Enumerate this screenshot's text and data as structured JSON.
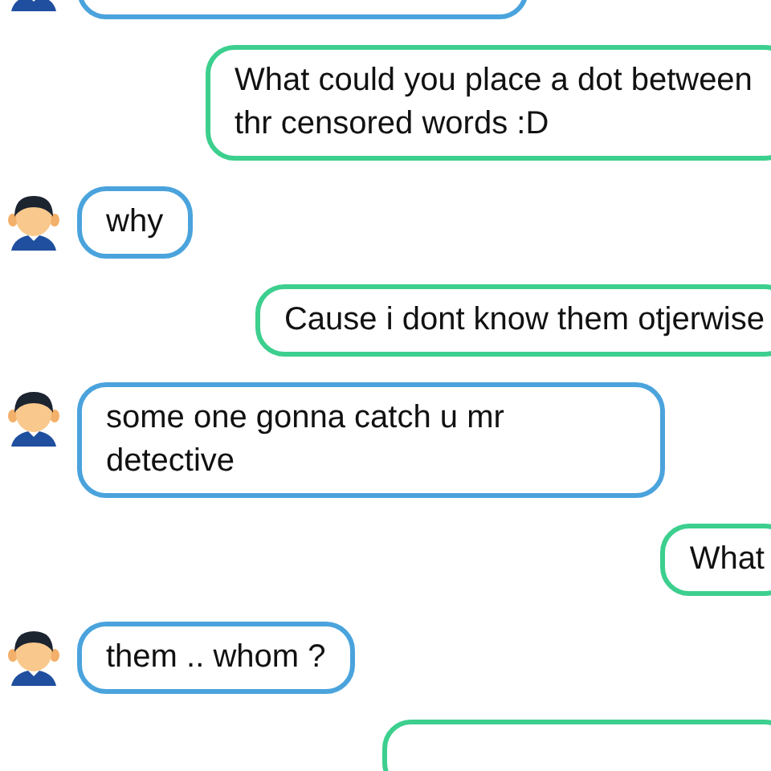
{
  "messages": [
    {
      "kind": "incoming"
    },
    {
      "kind": "outgoing",
      "text": "What could you place a dot between thr censored words :D"
    },
    {
      "kind": "incoming",
      "text": "why"
    },
    {
      "kind": "outgoing",
      "text": "Cause i dont know them otjerwise"
    },
    {
      "kind": "incoming",
      "text": "some one gonna catch u mr detective"
    },
    {
      "kind": "outgoing",
      "text": "What"
    },
    {
      "kind": "incoming",
      "text": "them .. whom ?"
    },
    {
      "kind": "outgoing"
    }
  ]
}
